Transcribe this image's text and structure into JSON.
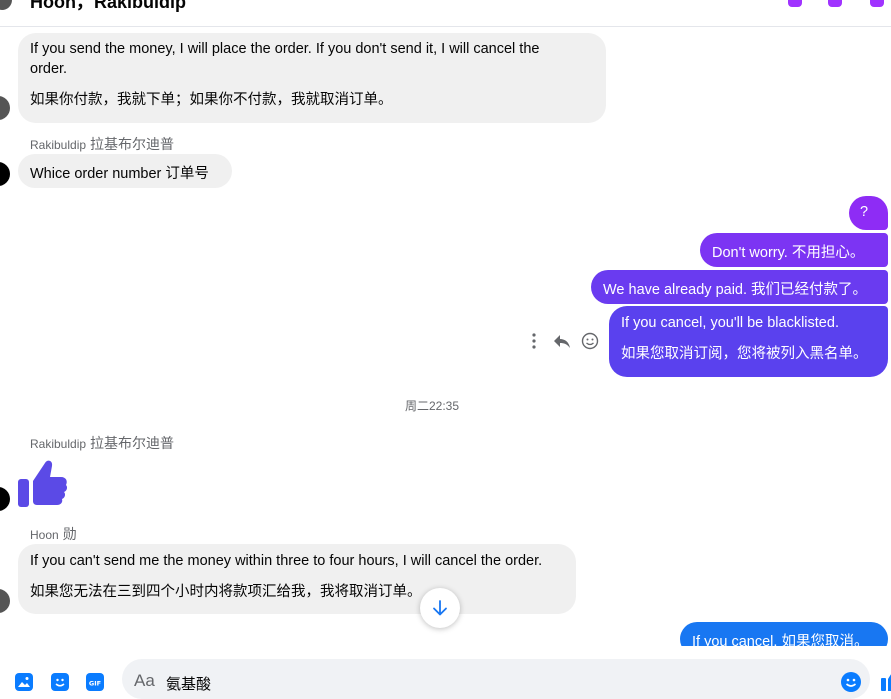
{
  "header": {
    "title": "Hoon，Rakibuldip"
  },
  "messages": {
    "m1": {
      "line1": "If you send the money, I will place the order. If you don't send it, I will cancel the",
      "line2": "order.",
      "line3": "如果你付款，我就下单；如果你不付款，我就取消订单。"
    },
    "sender1": {
      "name": "Rakibuldip",
      "name_cn": "拉基布尔迪普"
    },
    "m2": {
      "text": "Whice order number  订单号"
    },
    "o1": {
      "text": "?"
    },
    "o2": {
      "text": "Don't worry.  不用担心。"
    },
    "o3": {
      "text": "We have already paid.  我们已经付款了。"
    },
    "o4": {
      "line1": "If you cancel, you'll be blacklisted.",
      "line2": "如果您取消订阅，您将被列入黑名单。"
    },
    "timestamp": "周二22:35",
    "sender2": {
      "name": "Rakibuldip",
      "name_cn": "拉基布尔迪普"
    },
    "sender3": {
      "name": "Hoon",
      "name_cn": "勋"
    },
    "m3": {
      "line1": "If you can't send me the money within three to four hours, I will cancel the order.",
      "line2": "如果您无法在三到四个小时内将款项汇给我，我将取消订单。"
    },
    "o5": {
      "text": "If you cancel.  如果您取消。"
    }
  },
  "composer": {
    "aa_label": "Aa",
    "input_value": "氨基酸"
  },
  "colors": {
    "out_purple_top": "#8e2cf5",
    "out_purple_mid": "#6d3af0",
    "out_purple_bottom": "#5a41ee",
    "out_blue": "#1877f2",
    "like_color": "#5b4ae6",
    "incoming_bg": "#f0f0f0"
  },
  "icons": {
    "more": "more-icon",
    "reply": "reply-icon",
    "react": "emoji-icon",
    "like": "thumbs-up-icon",
    "scroll": "arrow-down-icon"
  }
}
